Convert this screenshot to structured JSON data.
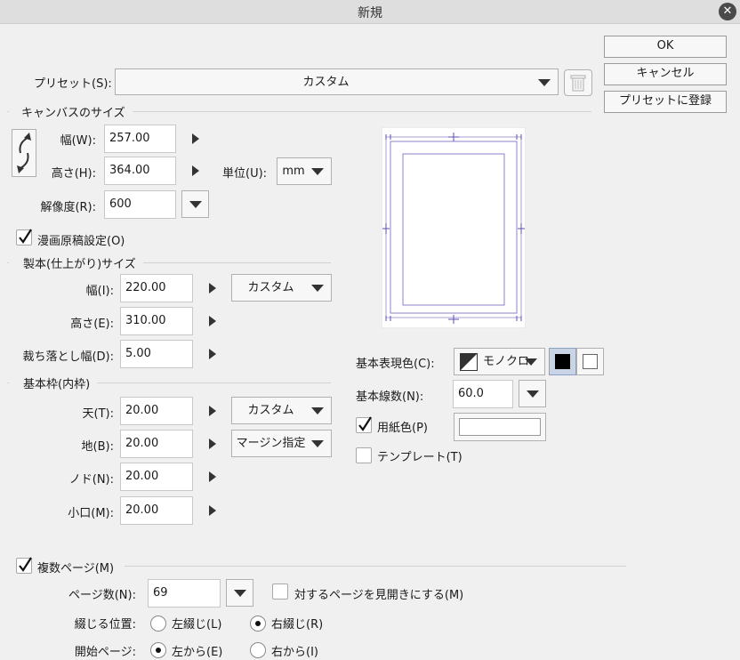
{
  "window": {
    "title": "新規"
  },
  "buttons": {
    "ok": "OK",
    "cancel": "キャンセル",
    "register_preset": "プリセットに登録"
  },
  "preset": {
    "label": "プリセット(S):",
    "value": "カスタム"
  },
  "canvas_size": {
    "section": "キャンバスのサイズ",
    "width_label": "幅(W):",
    "width_value": "257.00",
    "height_label": "高さ(H):",
    "height_value": "364.00",
    "unit_label": "単位(U):",
    "unit_value": "mm",
    "resolution_label": "解像度(R):",
    "resolution_value": "600"
  },
  "manga_settings": {
    "label": "漫画原稿設定(O)",
    "checked": true
  },
  "finish_size": {
    "section": "製本(仕上がり)サイズ",
    "width_label": "幅(I):",
    "width_value": "220.00",
    "preset_value": "カスタム",
    "height_label": "高さ(E):",
    "height_value": "310.00",
    "bleed_label": "裁ち落とし幅(D):",
    "bleed_value": "5.00"
  },
  "inner_frame": {
    "section": "基本枠(内枠)",
    "top_label": "天(T):",
    "top_value": "20.00",
    "top_preset": "カスタム",
    "bottom_label": "地(B):",
    "bottom_value": "20.00",
    "bottom_preset": "マージン指定",
    "gutter_label": "ノド(N):",
    "gutter_value": "20.00",
    "fore_edge_label": "小口(M):",
    "fore_edge_value": "20.00"
  },
  "expression": {
    "color_label": "基本表現色(C):",
    "color_value": "モノクロ",
    "lines_label": "基本線数(N):",
    "lines_value": "60.0",
    "paper_color_label": "用紙色(P)",
    "paper_color_checked": true,
    "template_label": "テンプレート(T)",
    "template_checked": false
  },
  "multi_page": {
    "label": "複数ページ(M)",
    "checked": true,
    "pages_label": "ページ数(N):",
    "pages_value": "69",
    "spread_label": "対するページを見開きにする(M)",
    "spread_checked": false,
    "binding_label": "綴じる位置:",
    "binding_left": "左綴じ(L)",
    "binding_right": "右綴じ(R)",
    "binding_selected": "right",
    "start_label": "開始ページ:",
    "start_left": "左から(E)",
    "start_right": "右から(I)",
    "start_selected": "left"
  }
}
